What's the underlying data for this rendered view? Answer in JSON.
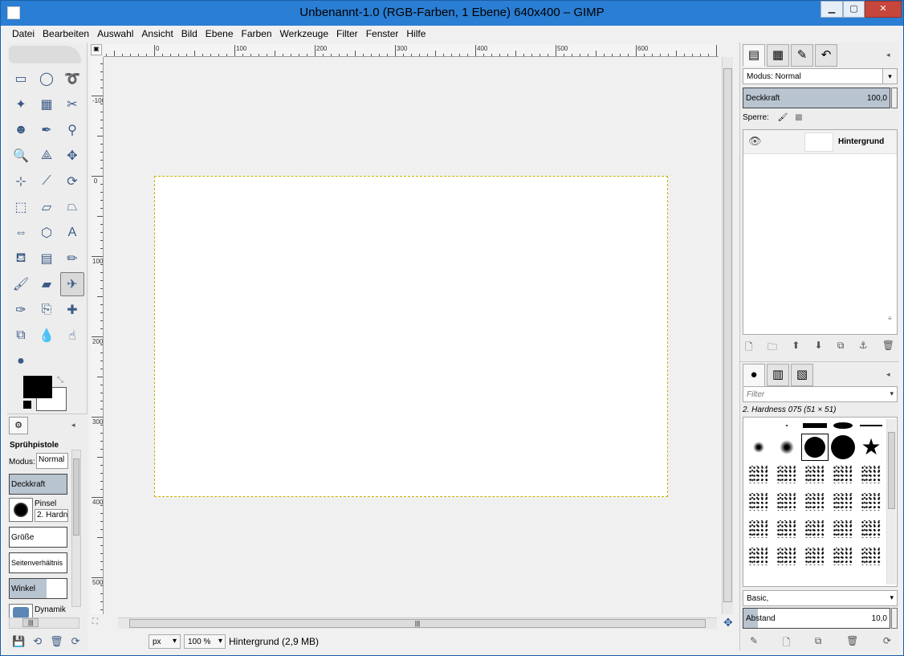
{
  "window": {
    "title": "Unbenannt-1.0 (RGB-Farben, 1 Ebene) 640x400 – GIMP",
    "min_label": "▁",
    "max_label": "▢",
    "close_label": "✕"
  },
  "menu": [
    "Datei",
    "Bearbeiten",
    "Auswahl",
    "Ansicht",
    "Bild",
    "Ebene",
    "Farben",
    "Werkzeuge",
    "Filter",
    "Fenster",
    "Hilfe"
  ],
  "toolbox": {
    "tools": [
      {
        "name": "rect-select-icon",
        "glyph": "▭"
      },
      {
        "name": "ellipse-select-icon",
        "glyph": "◯"
      },
      {
        "name": "free-select-icon",
        "glyph": "➰"
      },
      {
        "name": "fuzzy-select-icon",
        "glyph": "✦"
      },
      {
        "name": "color-select-icon",
        "glyph": "▦"
      },
      {
        "name": "scissors-icon",
        "glyph": "✂"
      },
      {
        "name": "foreground-select-icon",
        "glyph": "☻"
      },
      {
        "name": "paths-icon",
        "glyph": "✒"
      },
      {
        "name": "color-picker-icon",
        "glyph": "⚲"
      },
      {
        "name": "zoom-icon",
        "glyph": "🔍"
      },
      {
        "name": "measure-icon",
        "glyph": "⟁"
      },
      {
        "name": "move-icon",
        "glyph": "✥"
      },
      {
        "name": "align-icon",
        "glyph": "⊹"
      },
      {
        "name": "crop-icon",
        "glyph": "⟋"
      },
      {
        "name": "rotate-icon",
        "glyph": "⟳"
      },
      {
        "name": "scale-icon",
        "glyph": "⬚"
      },
      {
        "name": "shear-icon",
        "glyph": "▱"
      },
      {
        "name": "perspective-icon",
        "glyph": "⏢"
      },
      {
        "name": "flip-icon",
        "glyph": "⇔"
      },
      {
        "name": "cage-icon",
        "glyph": "⬡"
      },
      {
        "name": "text-icon",
        "glyph": "A"
      },
      {
        "name": "bucket-fill-icon",
        "glyph": "⛾"
      },
      {
        "name": "blend-icon",
        "glyph": "▤"
      },
      {
        "name": "pencil-icon",
        "glyph": "✏"
      },
      {
        "name": "paintbrush-icon",
        "glyph": "🖌"
      },
      {
        "name": "eraser-icon",
        "glyph": "▰"
      },
      {
        "name": "airbrush-icon",
        "glyph": "✈"
      },
      {
        "name": "ink-icon",
        "glyph": "✑"
      },
      {
        "name": "clone-icon",
        "glyph": "⎘"
      },
      {
        "name": "heal-icon",
        "glyph": "✚"
      },
      {
        "name": "perspective-clone-icon",
        "glyph": "⧉"
      },
      {
        "name": "blur-icon",
        "glyph": "💧"
      },
      {
        "name": "smudge-icon",
        "glyph": "☝"
      },
      {
        "name": "dodge-burn-icon",
        "glyph": "●"
      }
    ],
    "selected_tool_index": 26,
    "swap_glyph": "⤡"
  },
  "tool_options": {
    "tab_glyph": "⚙",
    "collapse_glyph": "◂",
    "tool_name": "Sprühpistole",
    "mode_label": "Modus:",
    "mode_value": "Normal",
    "opacity_label": "Deckkraft",
    "opacity_value": 1.0,
    "brush_label": "Pinsel",
    "brush_value": "2. Hardness 075",
    "size_label": "Größe",
    "size_value": 0.0,
    "aspect_label": "Seitenverhältnis",
    "aspect_value": 0.0,
    "angle_label": "Winkel",
    "angle_value": 0.65,
    "dynamics_label": "Dynamik",
    "hscroll_glyph": "|||",
    "bottom_icons": [
      "💾",
      "⟲",
      "🗑",
      "⟳"
    ]
  },
  "canvas": {
    "ruler_h_labels": [
      {
        "label": "0",
        "value": 0
      },
      {
        "label": "100",
        "value": 100
      },
      {
        "label": "200",
        "value": 200
      },
      {
        "label": "300",
        "value": 300
      },
      {
        "label": "400",
        "value": 400
      },
      {
        "label": "500",
        "value": 500
      },
      {
        "label": "600",
        "value": 600
      }
    ],
    "ruler_v_labels": [
      {
        "label": "-100",
        "value": -100
      },
      {
        "label": "0",
        "value": 0
      },
      {
        "label": "100",
        "value": 100
      },
      {
        "label": "200",
        "value": 200
      },
      {
        "label": "300",
        "value": 300
      },
      {
        "label": "400",
        "value": 400
      },
      {
        "label": "500",
        "value": 500
      }
    ],
    "image_width": 640,
    "image_height": 400,
    "quickmask_glyph": "▣",
    "zoom_corner_glyph": "⛶",
    "nav_glyph": "✥",
    "scroll_grip": "|||"
  },
  "status": {
    "unit": "px",
    "zoom": "100 %",
    "message": "Hintergrund (2,9 MB)",
    "dropdown_glyph": "▾"
  },
  "layers_dock": {
    "tabs": [
      {
        "name": "layers-tab-icon",
        "glyph": "▤"
      },
      {
        "name": "channels-tab-icon",
        "glyph": "▦"
      },
      {
        "name": "paths-tab-icon",
        "glyph": "✎"
      },
      {
        "name": "undo-tab-icon",
        "glyph": "↶"
      }
    ],
    "collapse_glyph": "◂",
    "mode_label": "Modus:",
    "mode_value": "Normal",
    "opacity_label": "Deckkraft",
    "opacity_value": "100,0",
    "lock_label": "Sperre:",
    "lock_icons": [
      "🖌",
      "▩"
    ],
    "layer_name": "Hintergrund",
    "eye_glyph": "👁",
    "bottom_icons": [
      "🗋",
      "🗀",
      "⬆",
      "⬇",
      "⧉",
      "⚓",
      "🗑"
    ],
    "scroll_glyph": "≡"
  },
  "brushes_dock": {
    "tabs": [
      {
        "name": "brushes-tab-icon",
        "glyph": "●"
      },
      {
        "name": "patterns-tab-icon",
        "glyph": "▥"
      },
      {
        "name": "gradients-tab-icon",
        "glyph": "▧"
      }
    ],
    "collapse_glyph": "◂",
    "filter_placeholder": "Filter",
    "selected_brush": "2. Hardness 075 (51 × 51)",
    "tag": "Basic,",
    "spacing_label": "Abstand",
    "spacing_value": "10,0",
    "spacing_fraction": 0.1,
    "bottom_icons": [
      "✎",
      "🗋",
      "⧉",
      "🗑",
      "⟳"
    ]
  },
  "colors": {
    "foreground": "#000000",
    "background": "#ffffff",
    "selection_marching_ants": "#c8b000",
    "titlebar": "#2a7ed3"
  }
}
